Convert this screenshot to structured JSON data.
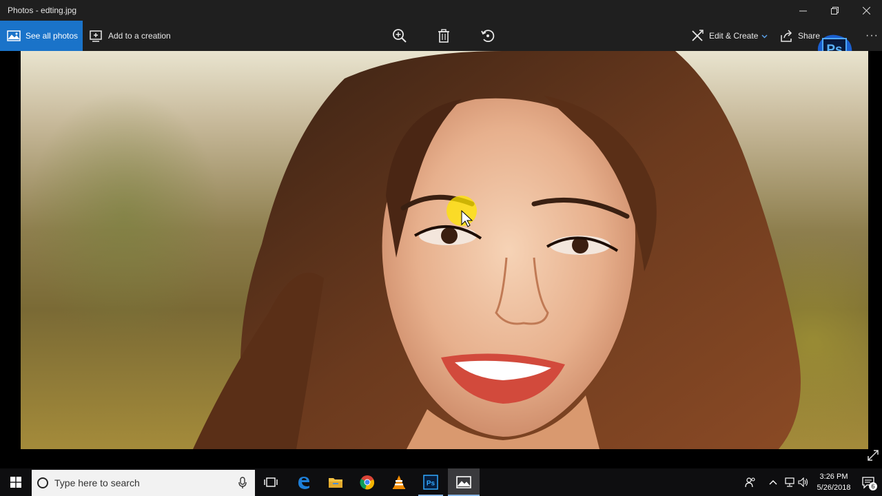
{
  "window": {
    "title": "Photos - edting.jpg"
  },
  "toolbar": {
    "see_all_label": "See all photos",
    "add_creation_label": "Add to a creation",
    "edit_create_label": "Edit & Create",
    "share_label": "Share",
    "more_label": "···"
  },
  "overlay": {
    "ps_badge_text": "Ps"
  },
  "taskbar": {
    "search_placeholder": "Type here to search",
    "pinned_icons": [
      "task-view-icon",
      "edge-icon",
      "file-explorer-icon",
      "chrome-icon",
      "vlc-icon",
      "photoshop-icon",
      "photos-icon"
    ],
    "ps_label": "Ps",
    "clock_time": "3:26 PM",
    "clock_date": "5/26/2018",
    "notification_count": "6"
  },
  "colors": {
    "accent": "#1a73c9",
    "chrome_bg": "#1f1f1f",
    "taskbar_bg": "#0e0e10"
  }
}
